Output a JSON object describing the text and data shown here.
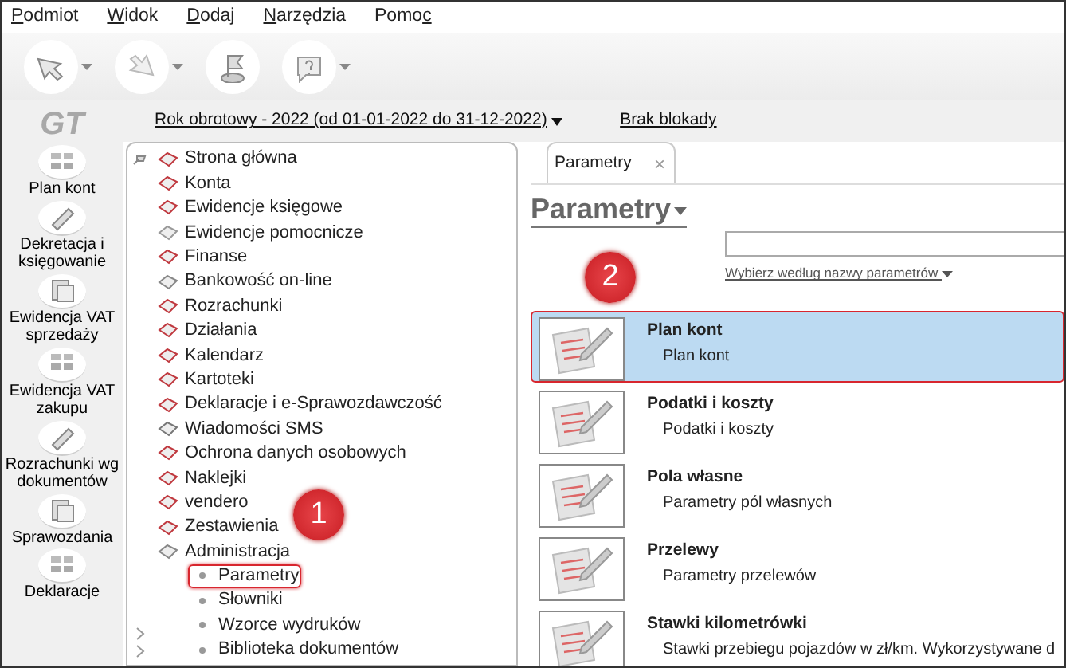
{
  "menu": [
    {
      "key": "P",
      "after": "odmiot"
    },
    {
      "key": "W",
      "after": "idok"
    },
    {
      "key": "D",
      "after": "odaj"
    },
    {
      "key": "N",
      "after": "arzędzia"
    },
    {
      "before": "Pomo",
      "key": "c"
    }
  ],
  "toolbar": [
    {
      "kind": "arrow-left",
      "dropdown": true
    },
    {
      "kind": "arrow-right",
      "dropdown": true
    },
    {
      "kind": "flag",
      "dropdown": false
    },
    {
      "kind": "help",
      "dropdown": true
    }
  ],
  "logo": "GT",
  "sidebar": {
    "items": [
      {
        "label": "Plan kont"
      },
      {
        "label": "Dekretacja i księgowanie"
      },
      {
        "label": "Ewidencja VAT sprzedaży"
      },
      {
        "label": "Ewidencja VAT zakupu"
      },
      {
        "label": "Rozrachunki wg dokumentów"
      },
      {
        "label": "Sprawozdania"
      },
      {
        "label": "Deklaracje"
      }
    ]
  },
  "info_bar": {
    "fiscal_year": "Rok obrotowy - 2022  (od 01-01-2022 do 31-12-2022)",
    "lock": "Brak blokady"
  },
  "tree": {
    "items": [
      {
        "label": "Strona główna",
        "selected": false
      },
      {
        "label": "Konta",
        "selected": false
      },
      {
        "label": "Ewidencje księgowe",
        "selected": false
      },
      {
        "label": "Ewidencje pomocnicze",
        "selected": false
      },
      {
        "label": "Finanse",
        "selected": false
      },
      {
        "label": "Bankowość on-line",
        "selected": false
      },
      {
        "label": "Rozrachunki",
        "selected": false
      },
      {
        "label": "Działania",
        "selected": false
      },
      {
        "label": "Kalendarz",
        "selected": false
      },
      {
        "label": "Kartoteki",
        "selected": false
      },
      {
        "label": "Deklaracje i e-Sprawozdawczość",
        "selected": false
      },
      {
        "label": "Wiadomości SMS",
        "selected": false
      },
      {
        "label": "Ochrona danych osobowych",
        "selected": false
      },
      {
        "label": "Naklejki",
        "selected": false
      },
      {
        "label": "vendero",
        "selected": false
      },
      {
        "label": "Zestawienia",
        "selected": false
      },
      {
        "label": "Administracja",
        "selected": false,
        "children": [
          {
            "label": "Parametry",
            "selected": true
          },
          {
            "label": "Słowniki",
            "selected": false
          },
          {
            "label": "Wzorce wydruków",
            "selected": false
          },
          {
            "label": "Biblioteka dokumentów",
            "selected": false
          }
        ]
      }
    ]
  },
  "tab": {
    "label": "Parametry",
    "close": "×"
  },
  "title": "Parametry",
  "filter_link": "Wybierz według nazwy parametrów",
  "parameters": [
    {
      "title": "Plan kont",
      "description": "Plan kont",
      "selected": true
    },
    {
      "title": "Podatki i koszty",
      "description": "Podatki i koszty",
      "selected": false
    },
    {
      "title": "Pola własne",
      "description": "Parametry pól własnych",
      "selected": false
    },
    {
      "title": "Przelewy",
      "description": "Parametry przelewów",
      "selected": false
    },
    {
      "title": "Stawki kilometrówki",
      "description": "Stawki przebiegu pojazdów w zł/km. Wykorzystywane d",
      "selected": false
    }
  ],
  "callouts": [
    {
      "number": "1"
    },
    {
      "number": "2"
    }
  ]
}
